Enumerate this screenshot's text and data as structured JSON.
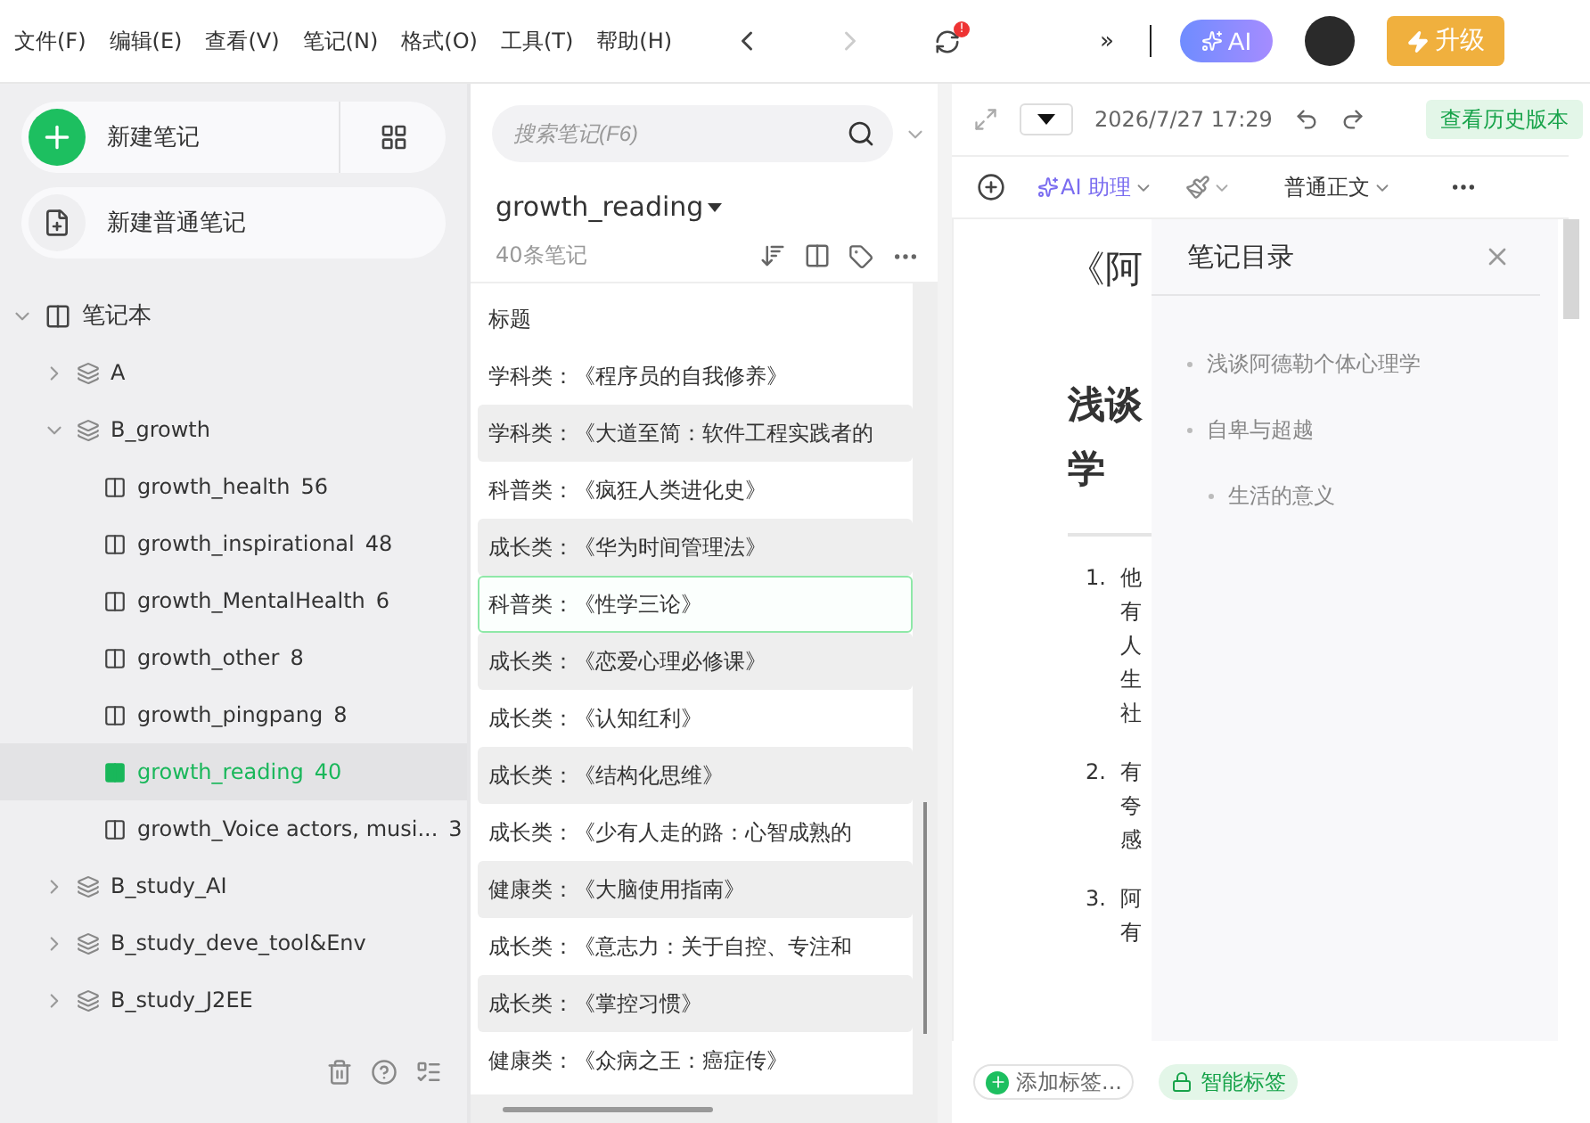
{
  "menu": [
    "文件(F)",
    "编辑(E)",
    "查看(V)",
    "笔记(N)",
    "格式(O)",
    "工具(T)",
    "帮助(H)"
  ],
  "toolbar": {
    "sync_alert": "!",
    "more": "»",
    "ai": "AI",
    "upgrade": "升级"
  },
  "sidebar": {
    "new_note": "新建笔记",
    "new_plain_note": "新建普通笔记",
    "tree": [
      {
        "kind": "root",
        "label": "笔记本",
        "expanded": true,
        "children": [
          {
            "kind": "stack",
            "label": "A",
            "expanded": false
          },
          {
            "kind": "stack",
            "label": "B_growth",
            "expanded": true,
            "children": [
              {
                "kind": "notebook",
                "label": "growth_health",
                "count": "56",
                "selected": false
              },
              {
                "kind": "notebook",
                "label": "growth_inspirational",
                "count": "48",
                "selected": false
              },
              {
                "kind": "notebook",
                "label": "growth_MentalHealth",
                "count": "6",
                "selected": false
              },
              {
                "kind": "notebook",
                "label": "growth_other",
                "count": "8",
                "selected": false
              },
              {
                "kind": "notebook",
                "label": "growth_pingpang",
                "count": "8",
                "selected": false
              },
              {
                "kind": "notebook",
                "label": "growth_reading",
                "count": "40",
                "selected": true
              },
              {
                "kind": "notebook",
                "label": "growth_Voice actors, musi...",
                "count": "3",
                "selected": false
              }
            ]
          },
          {
            "kind": "stack",
            "label": "B_study_AI",
            "expanded": false
          },
          {
            "kind": "stack",
            "label": "B_study_deve_tool&Env",
            "expanded": false
          },
          {
            "kind": "stack",
            "label": "B_study_J2EE",
            "expanded": false
          }
        ]
      }
    ]
  },
  "notes": {
    "search": {
      "placeholder": "搜索笔记(F6)"
    },
    "notebook": "growth_reading",
    "count": "40条笔记",
    "column": "标题",
    "rows": [
      {
        "title": "学科类：《程序员的自我修养》",
        "selected": false
      },
      {
        "title": "学科类：《大道至简：软件工程实践者的",
        "selected": false
      },
      {
        "title": "科普类：《疯狂人类进化史》",
        "selected": false
      },
      {
        "title": "成长类：《华为时间管理法》",
        "selected": false
      },
      {
        "title": "科普类：《性学三论》",
        "selected": true
      },
      {
        "title": "成长类：《恋爱心理必修课》",
        "selected": false
      },
      {
        "title": "成长类：《认知红利》",
        "selected": false
      },
      {
        "title": "成长类：《结构化思维》",
        "selected": false
      },
      {
        "title": "成长类：《少有人走的路：心智成熟的",
        "selected": false
      },
      {
        "title": "健康类：《大脑使用指南》",
        "selected": false
      },
      {
        "title": "成长类：《意志力：关于自控、专注和",
        "selected": false
      },
      {
        "title": "成长类：《掌控习惯》",
        "selected": false
      },
      {
        "title": "健康类：《众病之王：癌症传》",
        "selected": false
      }
    ]
  },
  "editor": {
    "date": "2026/7/27 17:29",
    "history": "查看历史版本",
    "ai_assistant": "AI 助理",
    "style": "普通正文",
    "title": "《阿",
    "heading": [
      "浅谈",
      "学"
    ],
    "list": [
      {
        "number": "1.",
        "lines": [
          "他",
          "有",
          "人",
          "生",
          "社"
        ]
      },
      {
        "number": "2.",
        "lines": [
          "有",
          "夸",
          "感"
        ]
      },
      {
        "number": "3.",
        "lines": [
          "阿",
          "有"
        ]
      }
    ],
    "outline": {
      "title": "笔记目录",
      "items": [
        {
          "text": "浅谈阿德勒个体心理学"
        },
        {
          "text": "自卑与超越",
          "children": [
            {
              "text": "生活的意义"
            }
          ]
        }
      ]
    },
    "tags": {
      "add": "添加标签...",
      "smart": "智能标签"
    }
  }
}
